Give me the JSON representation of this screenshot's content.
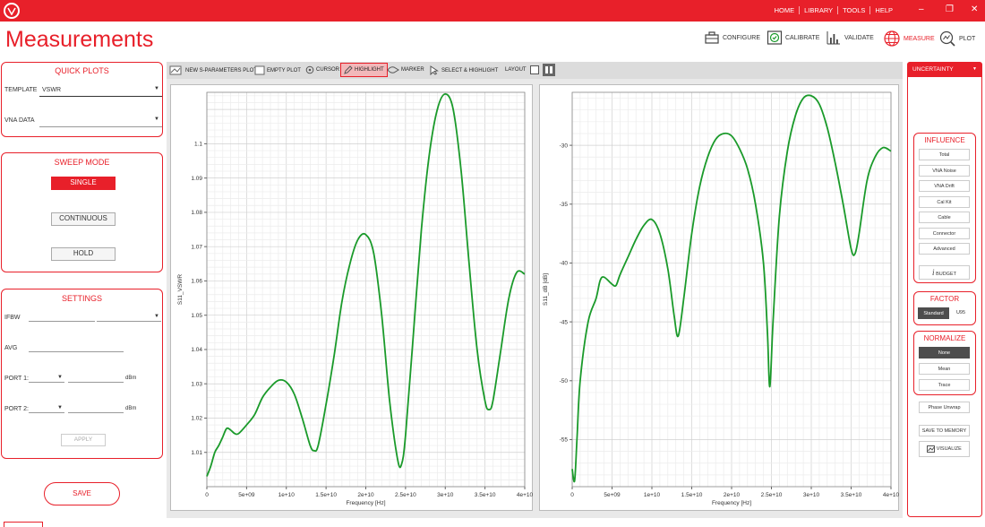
{
  "topbar": {
    "nav": [
      "HOME",
      "LIBRARY",
      "TOOLS",
      "HELP"
    ],
    "colors": {
      "accent": "#e8202a",
      "trace": "#1a9a2a",
      "selected_dark": "#4d4d4d"
    }
  },
  "page_title": "Measurements",
  "toolbar": {
    "configure": "CONFIGURE",
    "calibrate": "CALIBRATE",
    "validate": "VALIDATE",
    "measure": "MEASURE",
    "plot": "PLOT"
  },
  "quick_plots": {
    "title": "QUICK PLOTS",
    "template_label": "TEMPLATE",
    "template_value": "VSWR",
    "vna_data_label": "VNA DATA",
    "vna_data_value": ""
  },
  "sweep_mode": {
    "title": "SWEEP MODE",
    "single": "SINGLE",
    "continuous": "CONTINUOUS",
    "hold": "HOLD"
  },
  "settings": {
    "title": "SETTINGS",
    "ifbw_label": "IFBW",
    "avg_label": "AVG",
    "port1_label": "PORT 1:",
    "port2_label": "PORT 2:",
    "dbm1": "dBm",
    "dbm2": "dBm",
    "apply": "APPLY"
  },
  "save_button": "SAVE",
  "chart_toolbar": {
    "new_sparam": "NEW S-PARAMETERS PLOT",
    "empty_plot": "EMPTY PLOT",
    "cursor": "CURSOR",
    "highlight": "HIGHLIGHT",
    "marker": "MARKER",
    "select_highlight": "SELECT & HIGHLIGHT",
    "layout": "LAYOUT"
  },
  "right_panel": {
    "uncertainty": "UNCERTAINTY",
    "influence_title": "INFLUENCE",
    "influence_items": [
      "Total",
      "VNA Noise",
      "VNA Drift",
      "Cal Kit",
      "Cable",
      "Connector",
      "Advanced"
    ],
    "budget": "BUDGET",
    "factor_title": "FACTOR",
    "factor_standard": "Standard",
    "factor_u95": "U95",
    "normalize_title": "NORMALIZE",
    "normalize_items": [
      "None",
      "Mean",
      "Trace"
    ],
    "phase_unwrap": "Phase Unwrap",
    "save_to_memory": "SAVE TO MEMORY",
    "visualize": "VISUALIZE"
  },
  "chart_data": [
    {
      "type": "line",
      "xlabel": "Frequency [Hz]",
      "ylabel": "S11_VSWR",
      "xlim": [
        0,
        40000000000
      ],
      "ylim": [
        1.0,
        1.115
      ],
      "x_ticks": [
        "0",
        "5e+09",
        "1e+10",
        "1.5e+10",
        "2e+10",
        "2.5e+10",
        "3e+10",
        "3.5e+10",
        "4e+10"
      ],
      "y_ticks": [
        "1.01",
        "1.02",
        "1.03",
        "1.04",
        "1.05",
        "1.06",
        "1.07",
        "1.08",
        "1.09",
        "1.1"
      ],
      "grid": true,
      "series": [
        {
          "x": [
            0,
            500000000.0,
            1000000000.0,
            1500000000.0,
            2000000000.0,
            2500000000.0,
            3000000000.0,
            3500000000.0,
            4000000000.0,
            5000000000.0,
            6000000000.0,
            7000000000.0,
            8000000000.0,
            9000000000.0,
            10000000000.0,
            11000000000.0,
            12000000000.0,
            13000000000.0,
            13500000000.0,
            14000000000.0,
            15000000000.0,
            16000000000.0,
            17000000000.0,
            18000000000.0,
            19000000000.0,
            20000000000.0,
            21000000000.0,
            22000000000.0,
            23000000000.0,
            24000000000.0,
            24500000000.0,
            25000000000.0,
            26000000000.0,
            27000000000.0,
            28000000000.0,
            29000000000.0,
            30000000000.0,
            31000000000.0,
            32000000000.0,
            33000000000.0,
            34000000000.0,
            35000000000.0,
            35500000000.0,
            36000000000.0,
            37000000000.0,
            38000000000.0,
            39000000000.0,
            40000000000.0
          ],
          "y": [
            1.003,
            1.006,
            1.01,
            1.012,
            1.0145,
            1.017,
            1.0165,
            1.0155,
            1.0155,
            1.018,
            1.021,
            1.026,
            1.029,
            1.031,
            1.0305,
            1.027,
            1.02,
            1.012,
            1.0105,
            1.012,
            1.024,
            1.038,
            1.054,
            1.065,
            1.072,
            1.0735,
            1.068,
            1.05,
            1.025,
            1.008,
            1.0065,
            1.015,
            1.045,
            1.075,
            1.097,
            1.11,
            1.1145,
            1.11,
            1.092,
            1.065,
            1.04,
            1.025,
            1.0225,
            1.025,
            1.04,
            1.055,
            1.0625,
            1.062
          ]
        }
      ]
    },
    {
      "type": "line",
      "xlabel": "Frequency [Hz]",
      "ylabel": "S11_dB [dB]",
      "xlim": [
        0,
        40000000000
      ],
      "ylim": [
        -59,
        -25.5
      ],
      "x_ticks": [
        "0",
        "5e+09",
        "1e+10",
        "1.5e+10",
        "2e+10",
        "2.5e+10",
        "3e+10",
        "3.5e+10",
        "4e+10"
      ],
      "y_ticks": [
        "-55",
        "-50",
        "-45",
        "-40",
        "-35",
        "-30"
      ],
      "grid": true,
      "series": [
        {
          "x": [
            0,
            300000000.0,
            600000000.0,
            1000000000.0,
            2000000000.0,
            3000000000.0,
            3500000000.0,
            4000000000.0,
            5000000000.0,
            5500000000.0,
            6000000000.0,
            7000000000.0,
            8000000000.0,
            9000000000.0,
            10000000000.0,
            11000000000.0,
            12000000000.0,
            12800000000.0,
            13300000000.0,
            14000000000.0,
            15000000000.0,
            16000000000.0,
            17000000000.0,
            18000000000.0,
            19000000000.0,
            20000000000.0,
            21000000000.0,
            22000000000.0,
            23000000000.0,
            24000000000.0,
            24500000000.0,
            24800000000.0,
            25200000000.0,
            26000000000.0,
            27000000000.0,
            28000000000.0,
            29000000000.0,
            30000000000.0,
            31000000000.0,
            32000000000.0,
            33000000000.0,
            34000000000.0,
            35000000000.0,
            35500000000.0,
            36000000000.0,
            37000000000.0,
            38000000000.0,
            39000000000.0,
            40000000000.0
          ],
          "y": [
            -57.5,
            -58.5,
            -55,
            -50,
            -45,
            -43,
            -41.5,
            -41.2,
            -41.8,
            -41.9,
            -41,
            -39.5,
            -38,
            -36.8,
            -36.3,
            -37.5,
            -40.5,
            -44.5,
            -46.2,
            -43,
            -37.5,
            -33.5,
            -31,
            -29.5,
            -29,
            -29.2,
            -30.3,
            -32,
            -35,
            -40,
            -46,
            -50.5,
            -45,
            -36,
            -30.5,
            -27.5,
            -26,
            -25.8,
            -26.5,
            -28.5,
            -31.5,
            -35,
            -38.8,
            -39.2,
            -37.5,
            -33,
            -31,
            -30.2,
            -30.5
          ]
        }
      ]
    }
  ]
}
